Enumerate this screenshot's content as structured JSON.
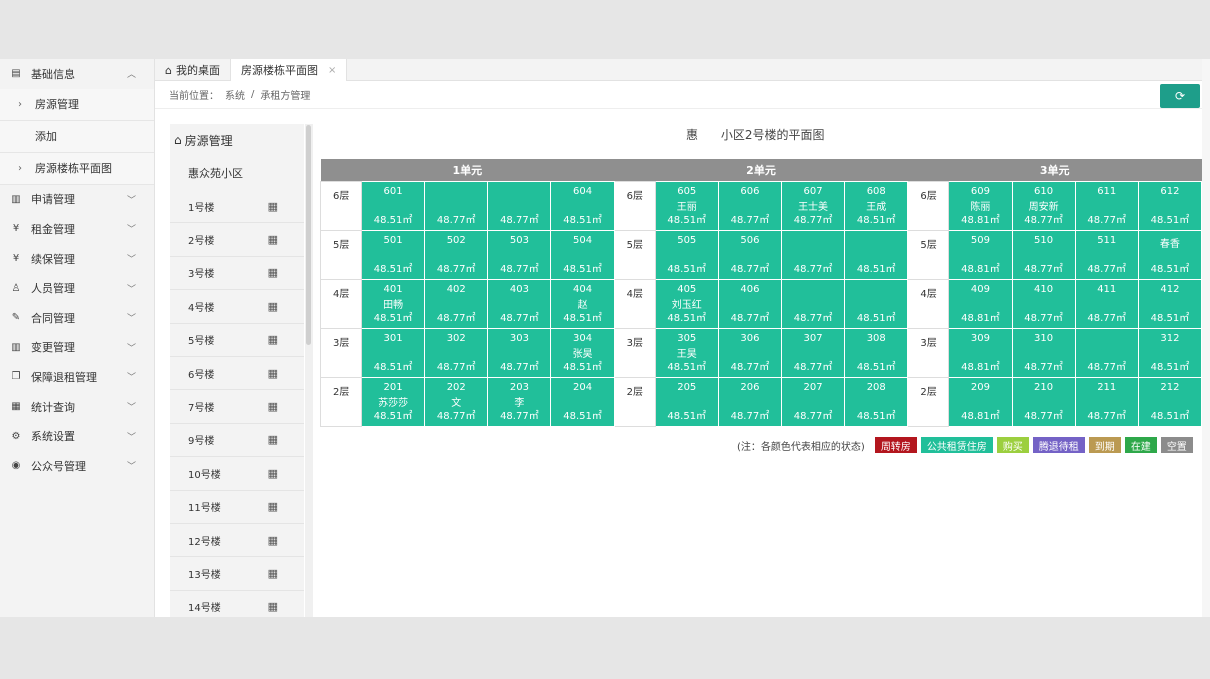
{
  "sidebar": {
    "items": [
      {
        "label": "基础信息",
        "icon": "document-icon",
        "chev": "up"
      },
      {
        "label": "房源管理",
        "sub": true,
        "arrow": true
      },
      {
        "label": "添加",
        "sub": true,
        "arrow": false
      },
      {
        "label": "房源楼栋平面图",
        "sub": true,
        "arrow": true
      },
      {
        "label": "申请管理",
        "icon": "building-icon",
        "chev": "down"
      },
      {
        "label": "租金管理",
        "icon": "yen-icon",
        "chev": "down"
      },
      {
        "label": "续保管理",
        "icon": "yen-icon",
        "chev": "down"
      },
      {
        "label": "人员管理",
        "icon": "user-icon",
        "chev": "down"
      },
      {
        "label": "合同管理",
        "icon": "edit-icon",
        "chev": "down"
      },
      {
        "label": "变更管理",
        "icon": "building-icon",
        "chev": "down"
      },
      {
        "label": "保障退租管理",
        "icon": "note-icon",
        "chev": "down"
      },
      {
        "label": "统计查询",
        "icon": "grid-icon",
        "chev": "down"
      },
      {
        "label": "系统设置",
        "icon": "gear-icon",
        "chev": "down"
      },
      {
        "label": "公众号管理",
        "icon": "wechat-icon",
        "chev": "down"
      }
    ]
  },
  "tabs": [
    {
      "label": "我的桌面",
      "home": true
    },
    {
      "label": "房源楼栋平面图",
      "active": true,
      "close": "×"
    }
  ],
  "breadcrumb": {
    "prefix": "当前位置：",
    "items": [
      "系统",
      "/",
      "承租方管理"
    ]
  },
  "blist": {
    "title": "房源管理",
    "estate": "惠众苑小区",
    "buildings": [
      "1号楼",
      "2号楼",
      "3号楼",
      "4号楼",
      "5号楼",
      "6号楼",
      "7号楼",
      "9号楼",
      "10号楼",
      "11号楼",
      "12号楼",
      "13号楼",
      "14号楼"
    ]
  },
  "plan": {
    "title": "惠      小区2号楼的平面图",
    "units": [
      "1单元",
      "2单元",
      "3单元"
    ],
    "floors": [
      {
        "label": "6层",
        "units": [
          [
            {
              "no": "601",
              "area": "48.51㎡",
              "s": "brown"
            },
            {
              "no": "",
              "area": "48.77㎡"
            },
            {
              "no": "",
              "area": "48.77㎡"
            },
            {
              "no": "604",
              "area": "48.51㎡"
            }
          ],
          [
            {
              "no": "605",
              "name": "王丽",
              "area": "48.51㎡"
            },
            {
              "no": "606",
              "area": "48.77㎡",
              "s": "grey"
            },
            {
              "no": "607",
              "name": "王士美",
              "area": "48.77㎡"
            },
            {
              "no": "608",
              "name": "王成",
              "area": "48.51㎡"
            }
          ],
          [
            {
              "no": "609",
              "name": "陈丽",
              "area": "48.81㎡"
            },
            {
              "no": "610",
              "name": "周安新",
              "area": "48.77㎡"
            },
            {
              "no": "611",
              "area": "48.77㎡",
              "s": "red"
            },
            {
              "no": "612",
              "area": "48.51㎡"
            }
          ]
        ]
      },
      {
        "label": "5层",
        "units": [
          [
            {
              "no": "501",
              "area": "48.51㎡"
            },
            {
              "no": "502",
              "area": "48.77㎡"
            },
            {
              "no": "503",
              "area": "48.77㎡"
            },
            {
              "no": "504",
              "area": "48.51㎡"
            }
          ],
          [
            {
              "no": "505",
              "area": "48.51㎡"
            },
            {
              "no": "506",
              "area": "48.77㎡"
            },
            {
              "no": "",
              "area": "48.77㎡",
              "s": "beige"
            },
            {
              "no": "",
              "area": "48.51㎡",
              "s": "cyan"
            }
          ],
          [
            {
              "no": "509",
              "area": "48.81㎡"
            },
            {
              "no": "510",
              "area": "48.77㎡"
            },
            {
              "no": "511",
              "area": "48.77㎡"
            },
            {
              "no": "",
              "name": "春香",
              "area": "48.51㎡"
            }
          ]
        ]
      },
      {
        "label": "4层",
        "units": [
          [
            {
              "no": "401",
              "name": "田畅",
              "area": "48.51㎡"
            },
            {
              "no": "402",
              "area": "48.77㎡"
            },
            {
              "no": "403",
              "area": "48.77㎡"
            },
            {
              "no": "404",
              "name": "赵",
              "area": "48.51㎡"
            }
          ],
          [
            {
              "no": "405",
              "name": "刘玉红",
              "area": "48.51㎡"
            },
            {
              "no": "406",
              "area": "48.77㎡"
            },
            {
              "no": "",
              "area": "48.77㎡"
            },
            {
              "no": "",
              "area": "48.51㎡"
            }
          ],
          [
            {
              "no": "409",
              "area": "48.81㎡"
            },
            {
              "no": "410",
              "area": "48.77㎡"
            },
            {
              "no": "411",
              "area": "48.77㎡"
            },
            {
              "no": "412",
              "area": "48.51㎡"
            }
          ]
        ]
      },
      {
        "label": "3层",
        "units": [
          [
            {
              "no": "301",
              "area": "48.51㎡"
            },
            {
              "no": "302",
              "area": "48.77㎡"
            },
            {
              "no": "303",
              "area": "48.77㎡"
            },
            {
              "no": "304",
              "name": "张昊",
              "area": "48.51㎡"
            }
          ],
          [
            {
              "no": "305",
              "name": "王昊",
              "area": "48.51㎡"
            },
            {
              "no": "306",
              "area": "48.77㎡"
            },
            {
              "no": "307",
              "area": "48.77㎡"
            },
            {
              "no": "308",
              "area": "48.51㎡"
            }
          ],
          [
            {
              "no": "309",
              "area": "48.81㎡",
              "s": "brown"
            },
            {
              "no": "310",
              "area": "48.77㎡"
            },
            {
              "no": "",
              "area": "48.77㎡",
              "s": "purple"
            },
            {
              "no": "312",
              "area": "48.51㎡"
            }
          ]
        ]
      },
      {
        "label": "2层",
        "units": [
          [
            {
              "no": "201",
              "name": "苏莎莎",
              "area": "48.51㎡"
            },
            {
              "no": "202",
              "name": "文",
              "area": "48.77㎡"
            },
            {
              "no": "203",
              "name": "李",
              "area": "48.77㎡"
            },
            {
              "no": "204",
              "area": "48.51㎡"
            }
          ],
          [
            {
              "no": "205",
              "area": "48.51㎡"
            },
            {
              "no": "206",
              "area": "48.77㎡"
            },
            {
              "no": "207",
              "area": "48.77㎡"
            },
            {
              "no": "208",
              "area": "48.51㎡"
            }
          ],
          [
            {
              "no": "209",
              "area": "48.81㎡"
            },
            {
              "no": "210",
              "area": "48.77㎡"
            },
            {
              "no": "211",
              "area": "48.77㎡"
            },
            {
              "no": "212",
              "area": "48.51㎡"
            }
          ]
        ]
      }
    ]
  },
  "legend": {
    "note": "(注：各颜色代表相应的状态)",
    "items": [
      {
        "label": "周转房",
        "color": "#b3161e"
      },
      {
        "label": "公共租赁住房",
        "color": "#21bf9a"
      },
      {
        "label": "购买",
        "color": "#9ccf3f"
      },
      {
        "label": "腾退待租",
        "color": "#7462c6"
      },
      {
        "label": "到期",
        "color": "#bb9a52"
      },
      {
        "label": "在建",
        "color": "#2ea84a"
      },
      {
        "label": "空置",
        "color": "#8c8c8c"
      }
    ]
  },
  "colors": {
    "accent": "#1e9e8a"
  }
}
